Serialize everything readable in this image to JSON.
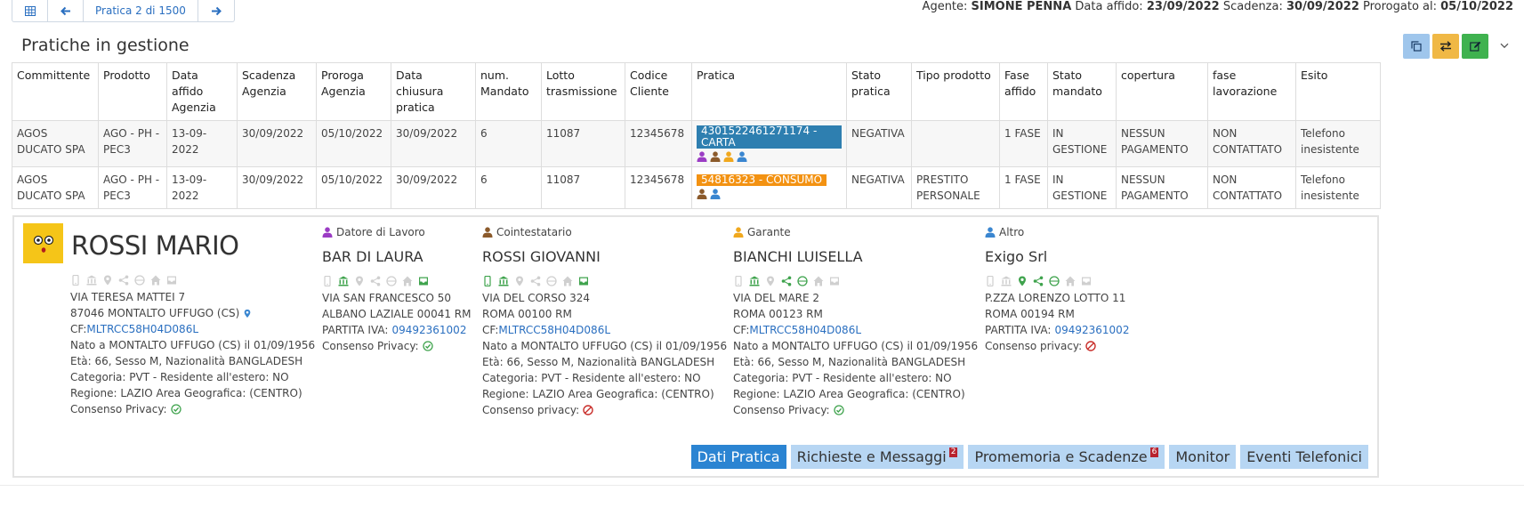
{
  "nav": {
    "position_label": "Pratica 2 di 1500"
  },
  "agent": {
    "agent_label": "Agente:",
    "agent_name": "SIMONE PENNA",
    "affido_label": "Data affido:",
    "affido_date": "23/09/2022",
    "scadenza_label": "Scadenza:",
    "scadenza_date": "30/09/2022",
    "prorogato_label": "Prorogato al:",
    "prorogato_date": "05/10/2022"
  },
  "page_title": "Pratiche in gestione",
  "colors": {
    "datore": "#9b3cc4",
    "cointestatario": "#8b5a2b",
    "garante": "#f0a81e",
    "altro": "#3a86d0",
    "ok": "#3fa34d",
    "no": "#c9302c"
  },
  "table": {
    "headers": [
      "Committente",
      "Prodotto",
      "Data affido Agenzia",
      "Scadenza Agenzia",
      "Proroga Agenzia",
      "Data chiusura pratica",
      "num. Mandato",
      "Lotto trasmissione",
      "Codice Cliente",
      "Pratica",
      "Stato pratica",
      "Tipo prodotto",
      "Fase affido",
      "Stato mandato",
      "copertura",
      "fase lavorazione",
      "Esito"
    ],
    "rows": [
      {
        "committente": "AGOS DUCATO SPA",
        "prodotto": "AGO - PH - PEC3",
        "data_affido": "13-09-2022",
        "scadenza": "30/09/2022",
        "proroga": "05/10/2022",
        "chiusura": "30/09/2022",
        "mandato": "6",
        "lotto": "11087",
        "codice": "12345678",
        "pratica": "4301522461271174 - CARTA",
        "stato": "NEGATIVA",
        "tipo": "",
        "fase": "1 FASE",
        "stato_mandato": "IN GESTIONE",
        "copertura": "NESSUN PAGAMENTO",
        "fase_lav": "NON CONTATTATO",
        "esito": "Telefono inesistente"
      },
      {
        "committente": "AGOS DUCATO SPA",
        "prodotto": "AGO - PH - PEC3",
        "data_affido": "13-09-2022",
        "scadenza": "30/09/2022",
        "proroga": "05/10/2022",
        "chiusura": "30/09/2022",
        "mandato": "6",
        "lotto": "11087",
        "codice": "12345678",
        "pratica": "54816323 - CONSUMO",
        "stato": "NEGATIVA",
        "tipo": "PRESTITO PERSONALE",
        "fase": "1 FASE",
        "stato_mandato": "IN GESTIONE",
        "copertura": "NESSUN PAGAMENTO",
        "fase_lav": "NON CONTATTATO",
        "esito": "Telefono inesistente"
      }
    ]
  },
  "debtor": {
    "name": "ROSSI MARIO",
    "address": "VIA TERESA MATTEI 7",
    "city": "87046 MONTALTO UFFUGO (CS)",
    "cf_label": "CF:",
    "cf": "MLTRCC58H04D086L",
    "born": "Nato a MONTALTO UFFUGO (CS) il 01/09/1956",
    "eta": "Età: 66, Sesso M, Nazionalità BANGLADESH",
    "categoria": "Categoria: PVT - Residente all'estero: NO",
    "regione": "Regione: LAZIO Area Geografica: (CENTRO)",
    "privacy": "Consenso Privacy:"
  },
  "datore": {
    "role": "Datore di Lavoro",
    "name": "BAR DI LAURA",
    "address": "VIA SAN FRANCESCO 50",
    "city": "ALBANO LAZIALE 00041 RM",
    "piva_label": "PARTITA IVA:",
    "piva": "09492361002",
    "privacy": "Consenso Privacy:"
  },
  "cointestatario": {
    "role": "Cointestatario",
    "name": "ROSSI GIOVANNI",
    "address": "VIA DEL CORSO 324",
    "city": "ROMA 00100 RM",
    "cf_label": "CF:",
    "cf": "MLTRCC58H04D086L",
    "born": "Nato a MONTALTO UFFUGO (CS) il 01/09/1956",
    "eta": "Età: 66, Sesso M, Nazionalità BANGLADESH",
    "categoria": "Categoria: PVT - Residente all'estero: NO",
    "regione": "Regione: LAZIO Area Geografica: (CENTRO)",
    "privacy": "Consenso privacy:"
  },
  "garante": {
    "role": "Garante",
    "name": "BIANCHI LUISELLA",
    "address": "VIA DEL MARE 2",
    "city": "ROMA 00123 RM",
    "cf_label": "CF:",
    "cf": "MLTRCC58H04D086L",
    "born": "Nato a MONTALTO UFFUGO (CS) il 01/09/1956",
    "eta": "Età: 66, Sesso M, Nazionalità BANGLADESH",
    "categoria": "Categoria: PVT - Residente all'estero: NO",
    "regione": "Regione: LAZIO Area Geografica: (CENTRO)",
    "privacy": "Consenso Privacy:"
  },
  "altro": {
    "role": "Altro",
    "name": "Exigo Srl",
    "address": "P.ZZA LORENZO LOTTO 11",
    "city": "ROMA 00194 RM",
    "piva_label": "PARTITA IVA:",
    "piva": "09492361002",
    "privacy": "Consenso privacy:"
  },
  "tabs": {
    "dati": "Dati Pratica",
    "richieste": "Richieste e Messaggi",
    "richieste_badge": "2",
    "promemoria": "Promemoria e Scadenze",
    "promemoria_badge": "6",
    "monitor": "Monitor",
    "eventi": "Eventi Telefonici"
  }
}
